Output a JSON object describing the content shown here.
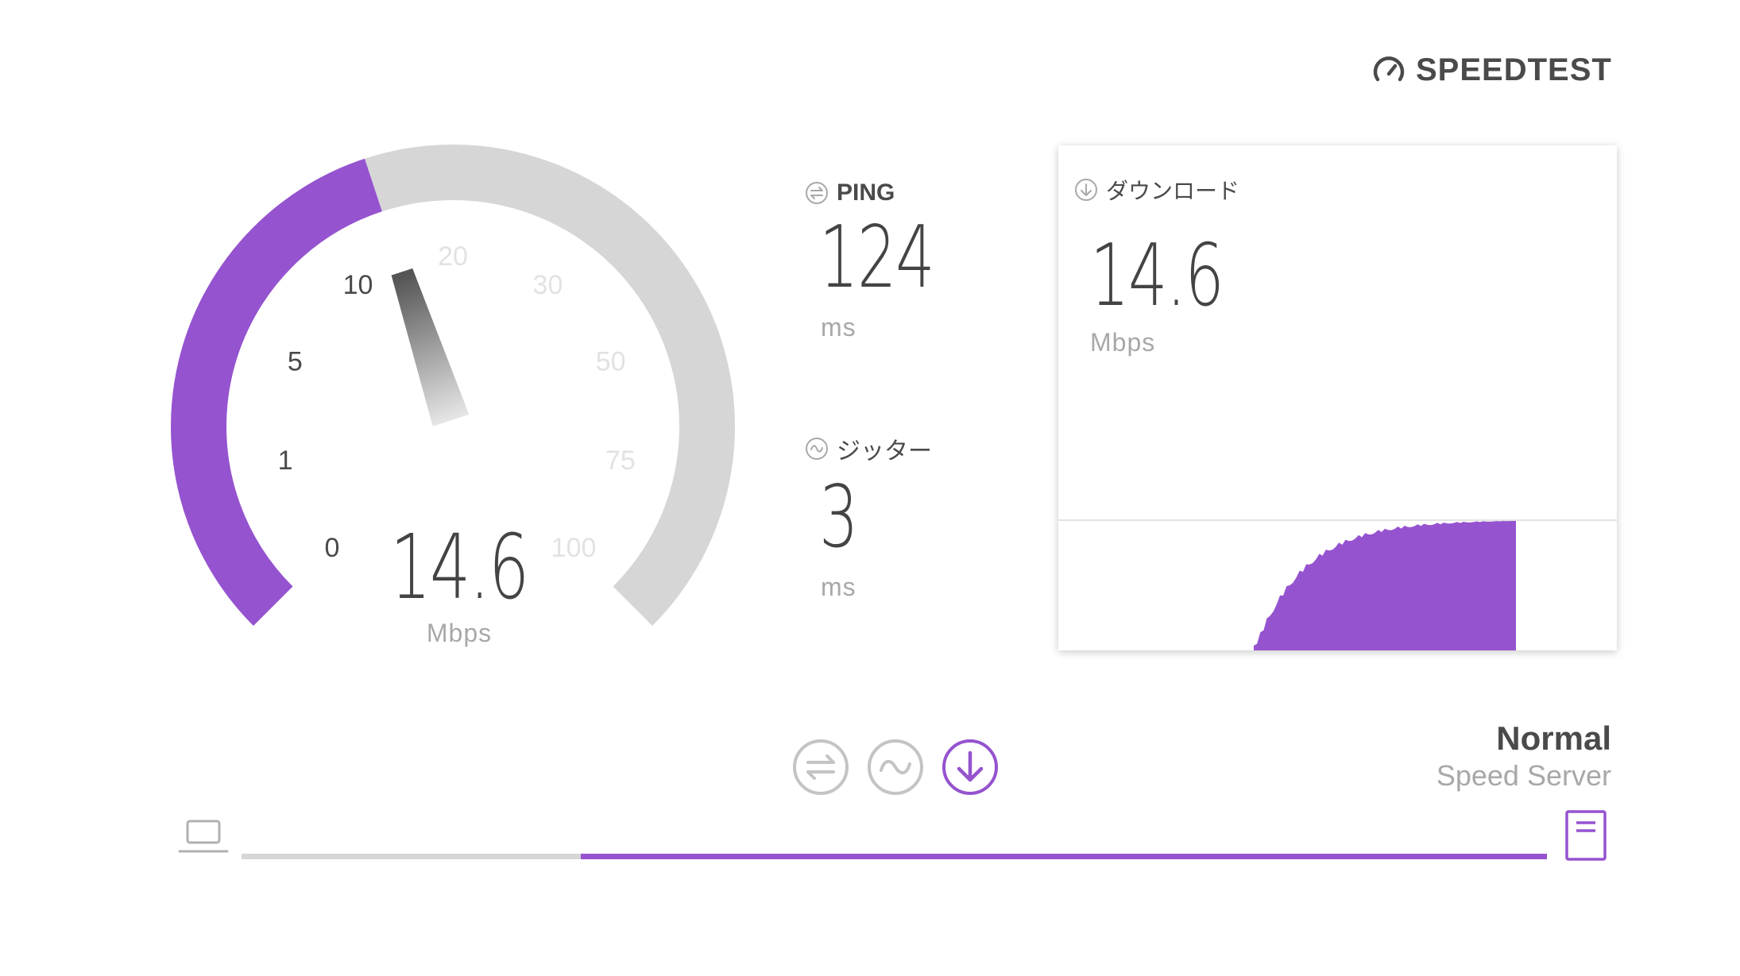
{
  "brand": {
    "name": "SPEEDTEST",
    "icon": "gauge-logo-icon"
  },
  "gauge": {
    "value": "14.6",
    "unit": "Mbps",
    "ticks": [
      "0",
      "1",
      "5",
      "10",
      "20",
      "30",
      "50",
      "75",
      "100"
    ],
    "fill_value": 14.6,
    "colors": {
      "fill": "#9553cf",
      "track": "#d6d6d6",
      "tick_active": "#4a4a4a",
      "tick_inactive": "#e2e2e2"
    }
  },
  "ping": {
    "label": "PING",
    "icon": "ping-arrows-icon",
    "value": "124",
    "unit": "ms"
  },
  "jitter": {
    "label": "ジッター",
    "icon": "jitter-wave-icon",
    "value": "3",
    "unit": "ms"
  },
  "download": {
    "label": "ダウンロード",
    "icon": "download-arrow-icon",
    "value": "14.6",
    "unit": "Mbps"
  },
  "steps": [
    {
      "name": "ping-step-icon",
      "state": "done"
    },
    {
      "name": "jitter-step-icon",
      "state": "done"
    },
    {
      "name": "download-step-icon",
      "state": "active"
    }
  ],
  "server": {
    "name": "Normal",
    "subtitle": "Speed Server"
  },
  "progress": {
    "fraction": 0.74
  },
  "colors": {
    "accent": "#9553cf",
    "text": "#4a4a4a",
    "muted": "#a8a8a8",
    "track": "#d6d6d6"
  }
}
